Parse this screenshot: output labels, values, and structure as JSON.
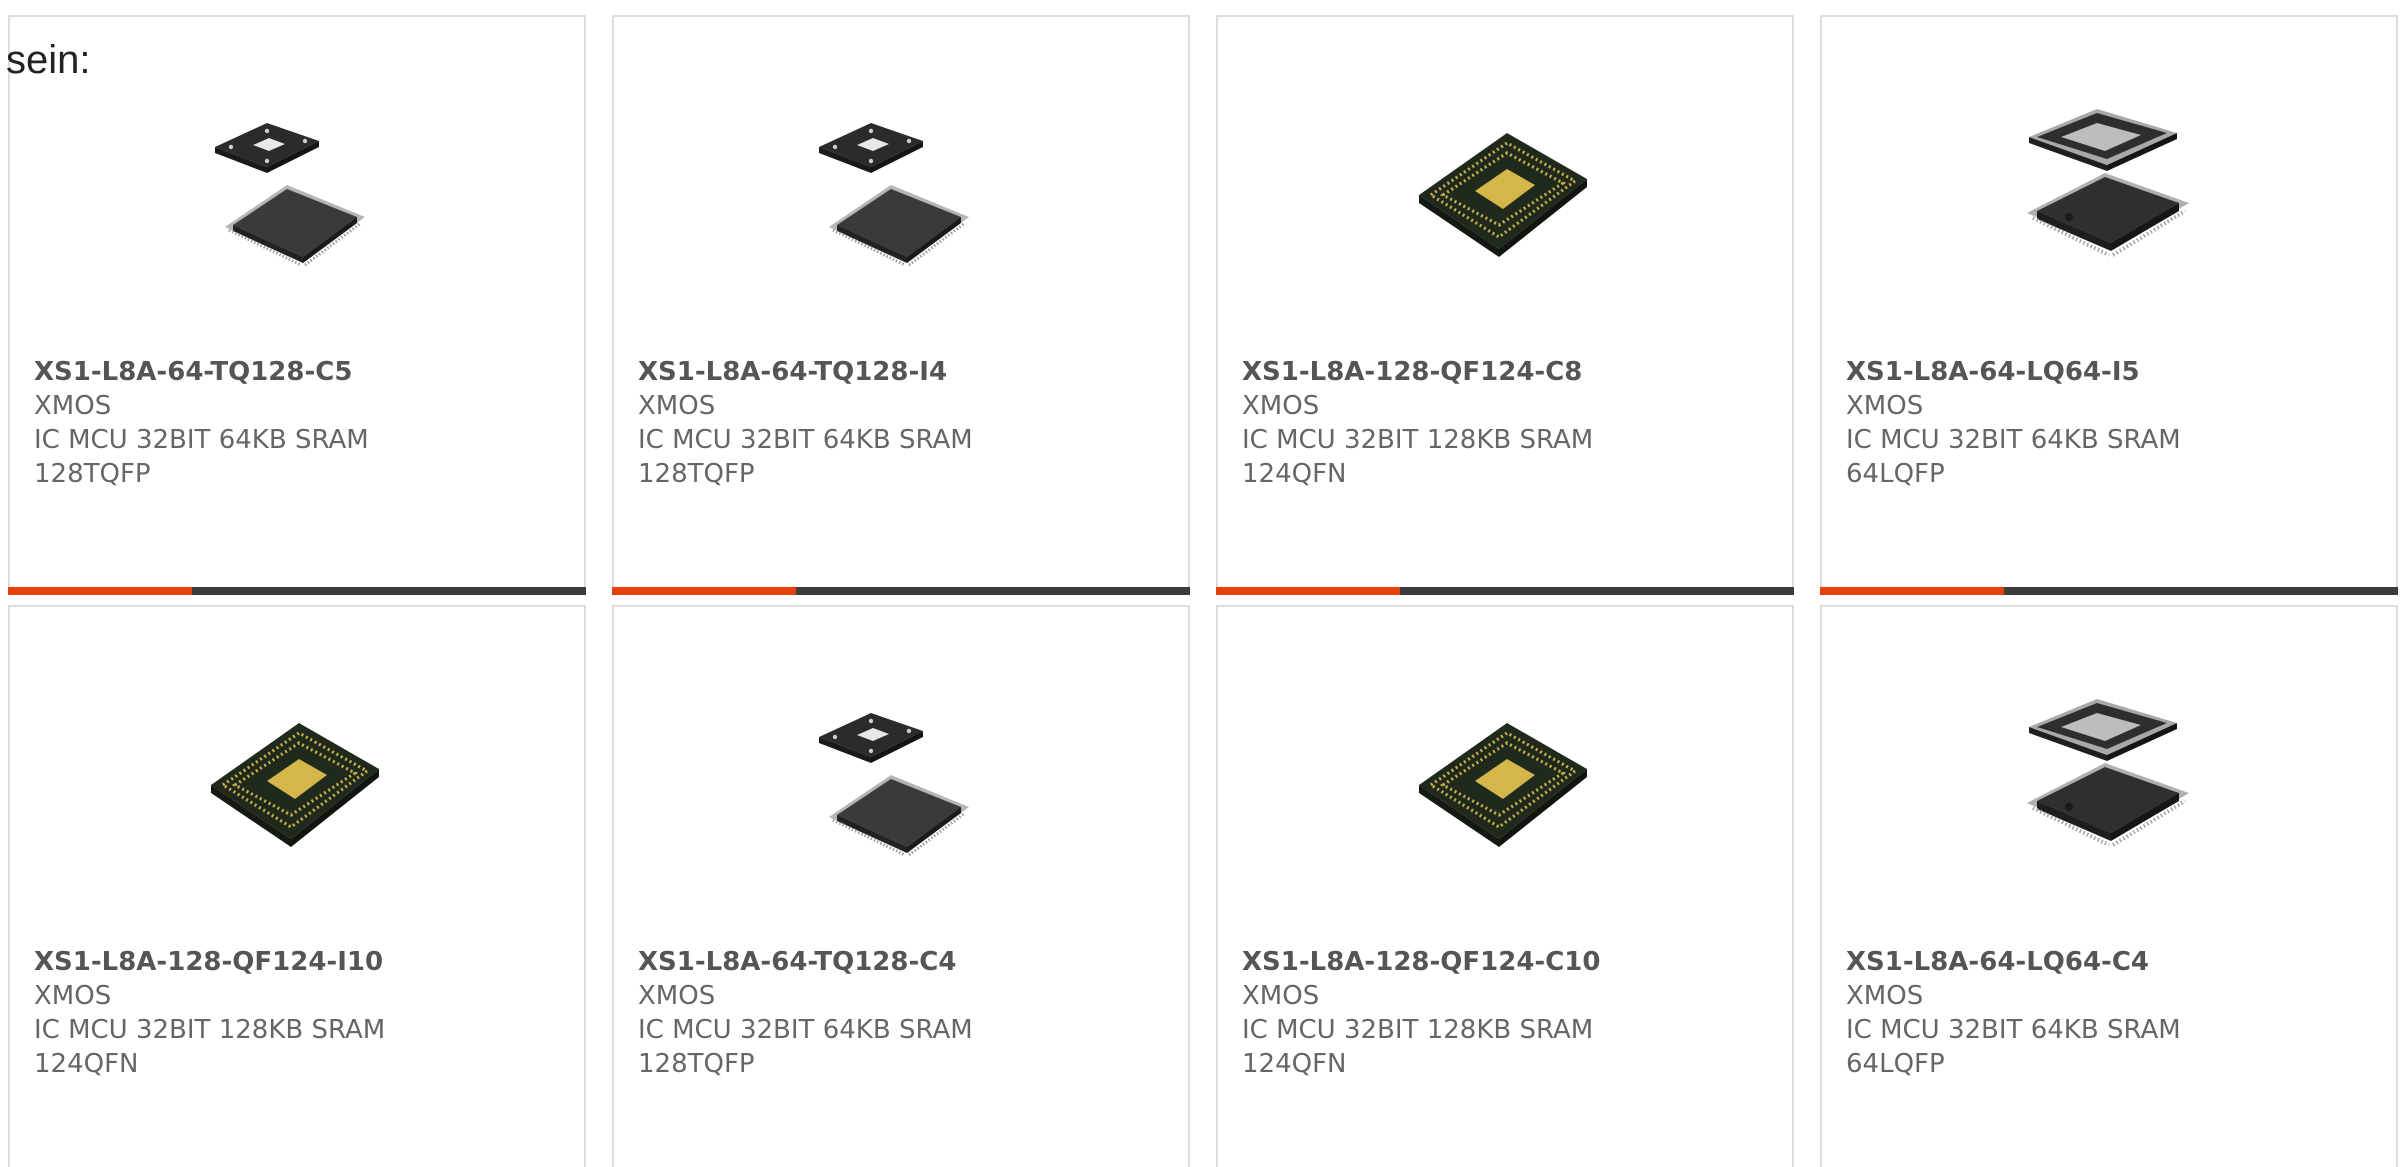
{
  "intro_text": "sein:",
  "colors": {
    "accent": "#e8400c",
    "bar": "#3c3c3c",
    "border": "#dddddd"
  },
  "products": [
    {
      "part": "XS1-L8A-64-TQ128-C5",
      "maker": "XMOS",
      "desc": "IC MCU 32BIT 64KB SRAM",
      "package": "128TQFP",
      "image": "tqfp-chip-image"
    },
    {
      "part": "XS1-L8A-64-TQ128-I4",
      "maker": "XMOS",
      "desc": "IC MCU 32BIT 64KB SRAM",
      "package": "128TQFP",
      "image": "tqfp-chip-image"
    },
    {
      "part": "XS1-L8A-128-QF124-C8",
      "maker": "XMOS",
      "desc": "IC MCU 32BIT 128KB SRAM",
      "package": "124QFN",
      "image": "qfn-chip-image"
    },
    {
      "part": "XS1-L8A-64-LQ64-I5",
      "maker": "XMOS",
      "desc": "IC MCU 32BIT 64KB SRAM",
      "package": "64LQFP",
      "image": "lqfp-chip-image"
    },
    {
      "part": "XS1-L8A-128-QF124-I10",
      "maker": "XMOS",
      "desc": "IC MCU 32BIT 128KB SRAM",
      "package": "124QFN",
      "image": "qfn-chip-image"
    },
    {
      "part": "XS1-L8A-64-TQ128-C4",
      "maker": "XMOS",
      "desc": "IC MCU 32BIT 64KB SRAM",
      "package": "128TQFP",
      "image": "tqfp-chip-image"
    },
    {
      "part": "XS1-L8A-128-QF124-C10",
      "maker": "XMOS",
      "desc": "IC MCU 32BIT 128KB SRAM",
      "package": "124QFN",
      "image": "qfn-chip-image"
    },
    {
      "part": "XS1-L8A-64-LQ64-C4",
      "maker": "XMOS",
      "desc": "IC MCU 32BIT 64KB SRAM",
      "package": "64LQFP",
      "image": "lqfp-chip-image"
    }
  ]
}
